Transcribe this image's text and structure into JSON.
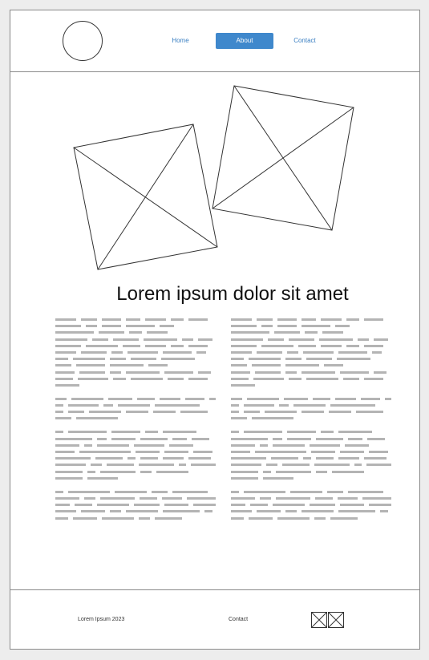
{
  "nav": {
    "home_label": "Home",
    "about_label": "About",
    "contact_label": "Contact",
    "active_color": "#3f88cc",
    "link_color": "#3a7fc2"
  },
  "main": {
    "title": "Lorem ipsum dolor sit amet"
  },
  "footer": {
    "copyright": "Lorem Ipsum 2023",
    "contact_label": "Contact",
    "social_icons": [
      "image-placeholder-icon",
      "image-placeholder-icon"
    ]
  }
}
